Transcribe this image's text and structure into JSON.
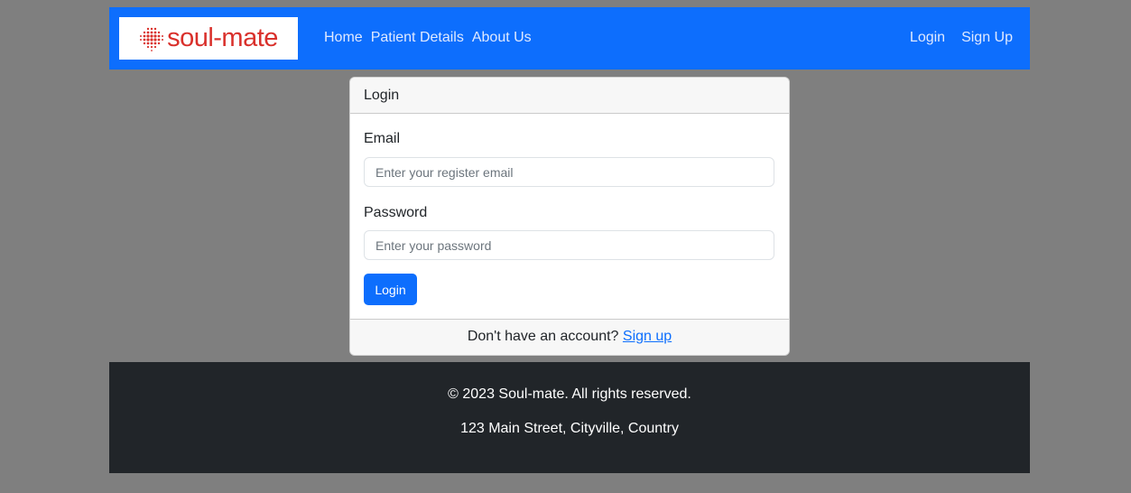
{
  "navbar": {
    "logo_text": "soul-mate",
    "links": [
      "Home",
      "Patient Details",
      "About Us"
    ],
    "right_links": [
      "Login",
      "Sign Up"
    ]
  },
  "login_card": {
    "header": "Login",
    "email_label": "Email",
    "email_placeholder": "Enter your register email",
    "password_label": "Password",
    "password_placeholder": "Enter your password",
    "button_label": "Login",
    "footer_text": "Don't have an account?",
    "signup_link": "Sign up"
  },
  "footer": {
    "copyright": "© 2023 Soul-mate. All rights reserved.",
    "address": "123 Main Street, Cityville, Country"
  },
  "colors": {
    "primary": "#0d6efd",
    "logo": "#d9302b",
    "footer_bg": "#212529",
    "page_bg": "#7f7f7f"
  }
}
